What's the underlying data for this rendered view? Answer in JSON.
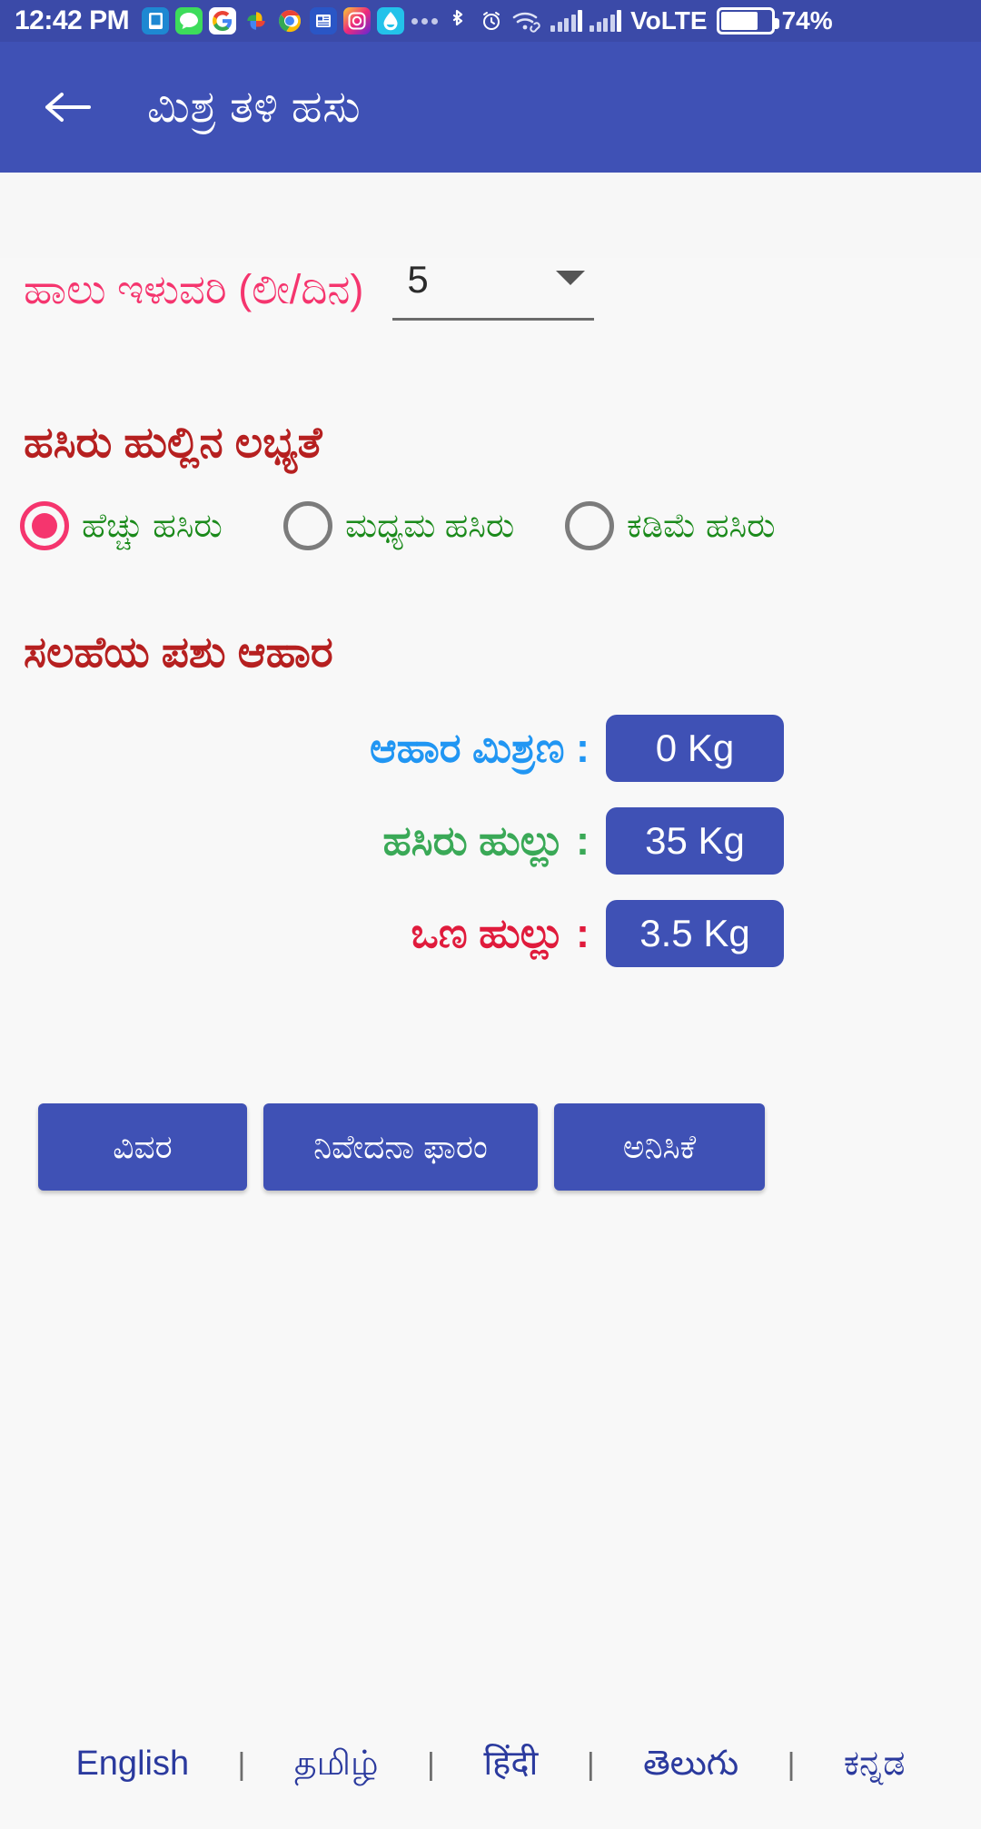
{
  "status_bar": {
    "time": "12:42 PM",
    "icons": [
      "sms-icon",
      "chat-icon",
      "google-icon",
      "photos-icon",
      "chrome-icon",
      "news-icon",
      "instagram-icon",
      "water-drop-icon",
      "more-dots-icon",
      "bluetooth-icon",
      "alarm-icon",
      "wifi-icon",
      "signal-1-icon",
      "signal-2-icon"
    ],
    "network_label": "VoLTE",
    "battery_percent": "74%"
  },
  "app_bar": {
    "back_label": "←",
    "title": "ಮಿಶ್ರ ತಳಿ ಹಸು"
  },
  "yield": {
    "label": "ಹಾಲು ಇಳುವರಿ (ಲೀ/ದಿನ)",
    "value": "5",
    "options": [
      "5"
    ]
  },
  "grass": {
    "heading": "ಹಸಿರು ಹುಲ್ಲಿನ ಲಭ್ಯತೆ",
    "options": [
      {
        "label": "ಹೆಚ್ಚು ಹಸಿರು",
        "selected": true
      },
      {
        "label": "ಮಧ್ಯಮ ಹಸಿರು",
        "selected": false
      },
      {
        "label": "ಕಡಿಮೆ ಹಸಿರು",
        "selected": false
      }
    ]
  },
  "feed": {
    "heading": "ಸಲಹೆಯ ಪಶು ಆಹಾರ",
    "rows": [
      {
        "label": "ಆಹಾರ ಮಿಶ್ರಣ :",
        "value": "0 Kg",
        "color": "#2196f3"
      },
      {
        "label": "ಹಸಿರು ಹುಲ್ಲು :",
        "value": "35 Kg",
        "color": "#3aa957"
      },
      {
        "label": "ಒಣ ಹುಲ್ಲು :",
        "value": "3.5 Kg",
        "color": "#e01b3c"
      }
    ]
  },
  "actions": [
    {
      "label": "ವಿವರ"
    },
    {
      "label": "ನಿವೇದನಾ ಫಾರಂ"
    },
    {
      "label": "ಅನಿಸಿಕೆ"
    }
  ],
  "languages": {
    "separator": "|",
    "items": [
      "English",
      "தமிழ்",
      "हिंदी",
      "తెలుగు",
      "ಕನ್ನಡ"
    ]
  },
  "colors": {
    "primary": "#3f51b5",
    "status_bar": "#3b4aa8",
    "accent_pink": "#f5356e",
    "heading_red": "#b62020",
    "green": "#1b8a1b",
    "background": "#f8f8f8"
  }
}
